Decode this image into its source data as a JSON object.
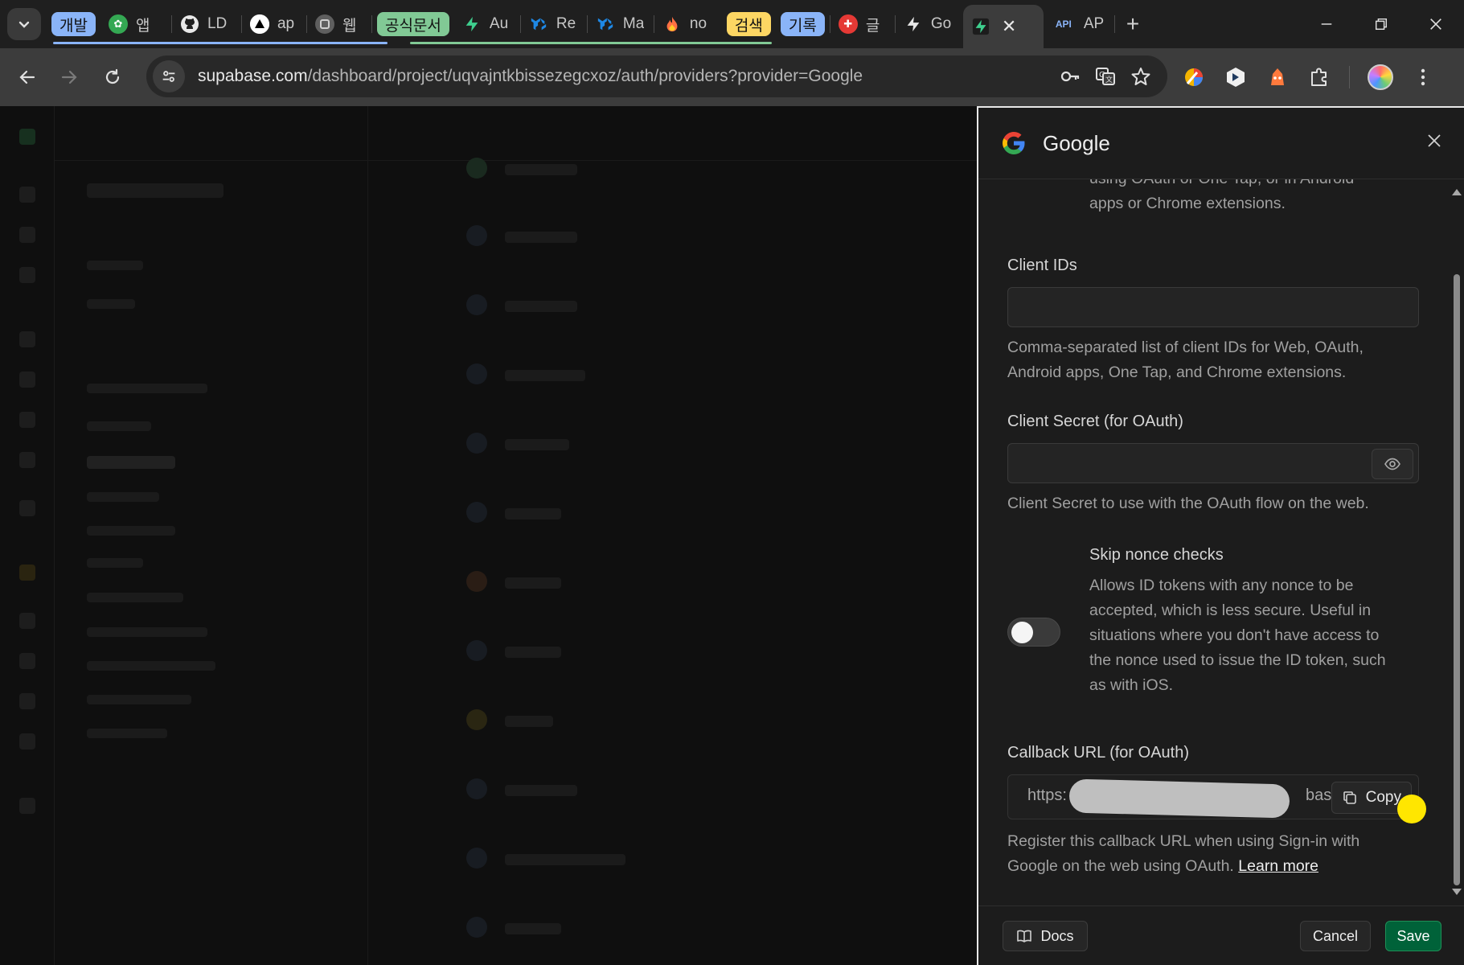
{
  "browser": {
    "tab_groups": [
      {
        "label": "개발",
        "color": "#8ab4f8"
      },
      {
        "label": "공식문서",
        "color": "#81c995"
      },
      {
        "label": "검색",
        "color": "#fdd663"
      },
      {
        "label": "기록",
        "color": "#8ab4f8"
      }
    ],
    "tabs": [
      {
        "label": "앱"
      },
      {
        "label": "LD"
      },
      {
        "label": "ap"
      },
      {
        "label": "웹"
      },
      {
        "label": "Au"
      },
      {
        "label": "Re"
      },
      {
        "label": "Ma"
      },
      {
        "label": "no"
      },
      {
        "label": "글"
      },
      {
        "label": "Go"
      },
      {
        "label": "AP",
        "favicon": "API"
      }
    ],
    "url": {
      "host": "supabase.com",
      "path": "/dashboard/project/uqvajntkbissezegcxoz/auth/providers?provider=Google"
    }
  },
  "panel": {
    "title": "Google",
    "intro_text_line1": "using OAuth or One Tap, or in Android",
    "intro_text_line2": "apps or Chrome extensions.",
    "client_ids": {
      "label": "Client IDs",
      "value": "",
      "help_line1": "Comma-separated list of client IDs for Web, OAuth,",
      "help_line2": "Android apps, One Tap, and Chrome extensions."
    },
    "client_secret": {
      "label": "Client Secret (for OAuth)",
      "value": "",
      "help": "Client Secret to use with the OAuth flow on the web."
    },
    "skip_nonce": {
      "label": "Skip nonce checks",
      "enabled": false,
      "help_lines": [
        "Allows ID tokens with any nonce to be",
        "accepted, which is less secure. Useful in",
        "situations where you don't have access to",
        "the nonce used to issue the ID token, such",
        "as with iOS."
      ]
    },
    "callback_url": {
      "label": "Callback URL (for OAuth)",
      "value_prefix": "https:",
      "value_suffix": "base.",
      "copy_label": "Copy",
      "help_line1": "Register this callback URL when using Sign-in with",
      "help_line2": "Google on the web using OAuth.",
      "learn_more": "Learn more"
    },
    "footer": {
      "docs_label": "Docs",
      "cancel_label": "Cancel",
      "save_label": "Save"
    }
  }
}
